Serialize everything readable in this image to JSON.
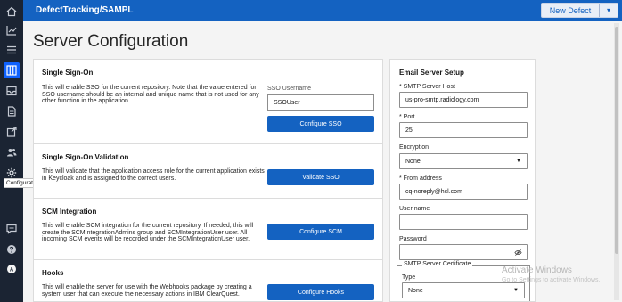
{
  "topbar": {
    "breadcrumb": "DefectTracking/SAMPL",
    "new_defect_label": "New Defect",
    "caret": "▾"
  },
  "page": {
    "title": "Server Configuration"
  },
  "rail": {
    "tooltip": "Configuration",
    "icons": [
      "home-icon",
      "chart-icon",
      "list-icon",
      "board-icon",
      "inbox-icon",
      "document-icon",
      "export-icon",
      "people-icon",
      "settings-icon",
      "chat-icon",
      "help-icon",
      "user-avatar-icon"
    ]
  },
  "sso": {
    "heading": "Single Sign-On",
    "description": "This will enable SSO for the current repository. Note that the value entered for SSO username should be an internal and unique name that is not used for any other function in the application.",
    "username_label": "SSO Username",
    "username_value": "SSOUser",
    "button": "Configure SSO"
  },
  "sso_validation": {
    "heading": "Single Sign-On Validation",
    "description": "This will validate that the application access role for the current application exists in Keycloak and is assigned to the correct users.",
    "button": "Validate SSO"
  },
  "scm": {
    "heading": "SCM Integration",
    "description": "This will enable SCM integration for the current repository. If needed, this will create the SCMIntegrationAdmins group and SCMIntegrationUser user. All incoming SCM events will be recorded under the SCMIntegrationUser user.",
    "button": "Configure SCM"
  },
  "hooks": {
    "heading": "Hooks",
    "description": "This will enable the server for use with the Webhooks package by creating a system user that can execute the necessary actions in IBM ClearQuest.",
    "button": "Configure Hooks"
  },
  "email": {
    "heading": "Email Server Setup",
    "smtp_host_label": "* SMTP Server Host",
    "smtp_host_value": "us-pro-smtp.radiology.com",
    "port_label": "* Port",
    "port_value": "25",
    "encryption_label": "Encryption",
    "encryption_value": "None",
    "from_label": "* From address",
    "from_value": "cq-noreply@hcl.com",
    "username_label": "User name",
    "username_value": "",
    "password_label": "Password",
    "password_value": "",
    "cert_legend": "SMTP Server Certificate",
    "type_label": "Type",
    "type_value": "None"
  },
  "watermark": {
    "line1": "Activate Windows",
    "line2": "Go to Settings to activate Windows."
  }
}
